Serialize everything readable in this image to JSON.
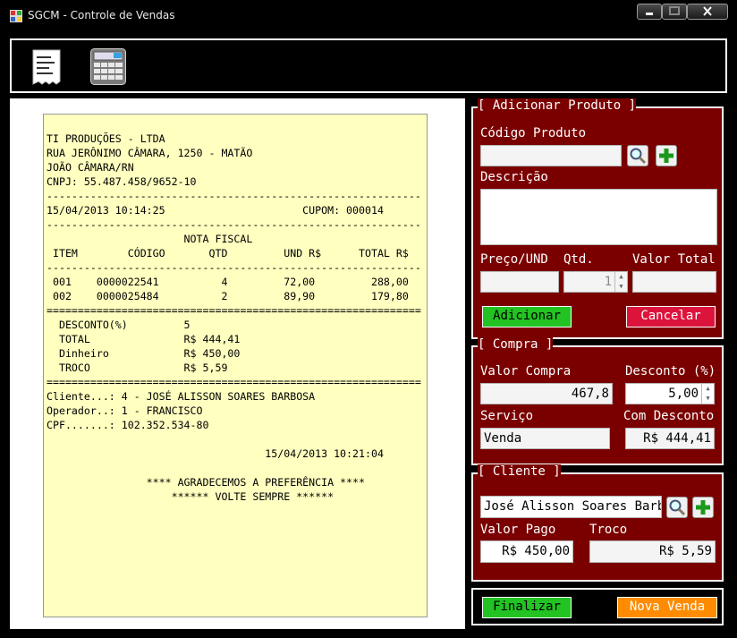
{
  "window": {
    "title": "SGCM - Controle de Vendas"
  },
  "toolbar": {
    "receipt_icon": "receipt-icon",
    "calculator_icon": "calculator-icon"
  },
  "receipt": {
    "lines": [
      "TI PRODUÇÕES - LTDA",
      "RUA JERÔNIMO CÂMARA, 1250 - MATÃO",
      "JOÃO CÂMARA/RN",
      "CNPJ: 55.487.458/9652-10",
      "------------------------------------------------------------",
      "15/04/2013 10:14:25                      CUPOM: 000014",
      "------------------------------------------------------------",
      "                      NOTA FISCAL",
      " ITEM        CÓDIGO       QTD         UND R$      TOTAL R$",
      "------------------------------------------------------------",
      " 001    0000022541          4         72,00         288,00",
      " 002    0000025484          2         89,90         179,80",
      "============================================================",
      "  DESCONTO(%)         5",
      "  TOTAL               R$ 444,41",
      "  Dinheiro            R$ 450,00",
      "  TROCO               R$ 5,59",
      "============================================================",
      "Cliente...: 4 - JOSÉ ALISSON SOARES BARBOSA",
      "Operador..: 1 - FRANCISCO",
      "CPF.......: 102.352.534-80",
      "",
      "                                   15/04/2013 10:21:04",
      "",
      "                **** AGRADECEMOS A PREFERÊNCIA ****",
      "                    ****** VOLTE SEMPRE ******"
    ]
  },
  "adicionar": {
    "title": "[ Adicionar Produto ]",
    "codigo_label": "Código Produto",
    "codigo_value": "",
    "descricao_label": "Descrição",
    "descricao_value": "",
    "preco_label": "Preço/UND",
    "qtd_label": "Qtd.",
    "valor_total_label": "Valor Total",
    "preco_value": "",
    "qtd_value": "1",
    "valor_total_value": "",
    "adicionar_button": "Adicionar",
    "cancelar_button": "Cancelar"
  },
  "compra": {
    "title": "[ Compra ]",
    "valor_compra_label": "Valor Compra",
    "desconto_label": "Desconto (%)",
    "valor_compra_value": "467,8",
    "desconto_value": "5,00",
    "servico_label": "Serviço",
    "com_desconto_label": "Com Desconto",
    "servico_value": "Venda",
    "com_desconto_value": "R$ 444,41"
  },
  "cliente": {
    "title": "[ Cliente ]",
    "nome_value": "José Alisson Soares Barbo",
    "valor_pago_label": "Valor Pago",
    "troco_label": "Troco",
    "valor_pago_value": "R$ 450,00",
    "troco_value": "R$ 5,59"
  },
  "actions": {
    "finalizar_button": "Finalizar",
    "nova_venda_button": "Nova Venda"
  },
  "colors": {
    "panel_red": "#7a0000",
    "green_button": "#22c322",
    "red_button": "#dc143c",
    "orange_button": "#ff8c00",
    "receipt_bg": "#ffffc0"
  }
}
